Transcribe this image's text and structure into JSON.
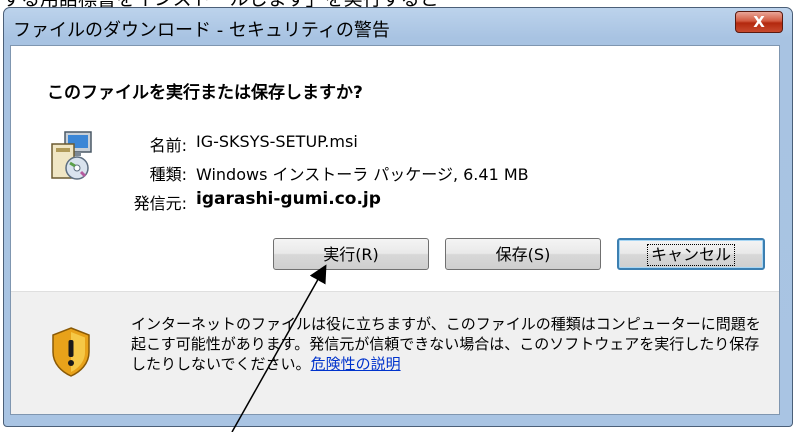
{
  "caption": "する用語標書をインストールします」を実行すると",
  "window": {
    "title": "ファイルのダウンロード - セキュリティの警告",
    "close_label": "X"
  },
  "question": "このファイルを実行または保存しますか?",
  "file": {
    "name_label": "名前:",
    "name_value": "IG-SKSYS-SETUP.msi",
    "type_label": "種類:",
    "type_value": "Windows インストーラ パッケージ, 6.41 MB",
    "from_label": "発信元:",
    "from_value": "igarashi-gumi.co.jp"
  },
  "buttons": {
    "run": "実行(R)",
    "save": "保存(S)",
    "cancel": "キャンセル"
  },
  "warning": {
    "text": "インターネットのファイルは役に立ちますが、このファイルの種類はコンピューターに問題を起こす可能性があります。発信元が信頼できない場合は、このソフトウェアを実行したり保存したりしないでください。",
    "link": "危険性の説明"
  },
  "icons": {
    "app": "installer-package-icon",
    "warning": "shield-warning-icon",
    "close": "close-icon"
  }
}
